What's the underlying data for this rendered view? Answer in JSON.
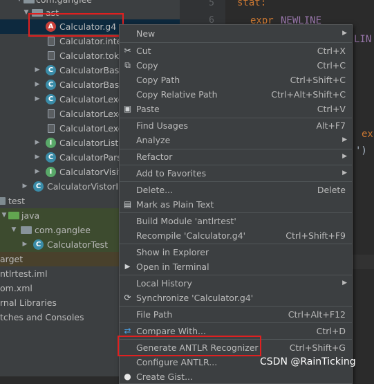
{
  "tree": {
    "partial_top": "com.ganglee",
    "partial_ast": "ast",
    "items": [
      {
        "label": "Calculator.g4",
        "icon": "antlr-file-icon"
      },
      {
        "label": "Calculator.inter",
        "icon": "text-file-icon"
      },
      {
        "label": "Calculator.toke",
        "icon": "text-file-icon"
      },
      {
        "label": "CalculatorBase",
        "icon": "class-icon"
      },
      {
        "label": "CalculatorBase",
        "icon": "class-icon"
      },
      {
        "label": "CalculatorLexer",
        "icon": "class-icon"
      },
      {
        "label": "CalculatorLexer",
        "icon": "text-file-icon"
      },
      {
        "label": "CalculatorLexer",
        "icon": "text-file-icon"
      },
      {
        "label": "CalculatorLister",
        "icon": "interface-icon"
      },
      {
        "label": "CalculatorParse",
        "icon": "class-icon"
      },
      {
        "label": "CalculatorVisito",
        "icon": "interface-icon"
      },
      {
        "label": "CalculatorVistorIm",
        "icon": "class-icon"
      },
      {
        "label": "test",
        "icon": "folder-icon"
      },
      {
        "label": "java",
        "icon": "folder-icon"
      },
      {
        "label": "com.ganglee",
        "icon": "package-icon"
      },
      {
        "label": "CalculatorTest",
        "icon": "class-icon"
      },
      {
        "label": "arget",
        "icon": "folder-icon"
      },
      {
        "label": "ntlrtest.iml",
        "icon": "file-icon"
      },
      {
        "label": "om.xml",
        "icon": "file-icon"
      },
      {
        "label": "rnal Libraries",
        "icon": "library-icon"
      },
      {
        "label": "tches and Consoles",
        "icon": "scratch-icon"
      }
    ]
  },
  "editor": {
    "line_numbers": [
      "5",
      "6"
    ],
    "code": {
      "stat": "stat:",
      "expr": "expr",
      "newline": "NEWLINE",
      "partial_newline2": "LIN",
      "partial_ex": "ex",
      "partial_paren": "')"
    }
  },
  "menu": {
    "items": [
      {
        "label": "New",
        "shortcut": "",
        "submenu": true,
        "icon": ""
      },
      {
        "label": "Cut",
        "shortcut": "Ctrl+X",
        "submenu": false,
        "icon": "cut-icon"
      },
      {
        "label": "Copy",
        "shortcut": "Ctrl+C",
        "submenu": false,
        "icon": "copy-icon"
      },
      {
        "label": "Copy Path",
        "shortcut": "Ctrl+Shift+C",
        "submenu": false,
        "icon": ""
      },
      {
        "label": "Copy Relative Path",
        "shortcut": "Ctrl+Alt+Shift+C",
        "submenu": false,
        "icon": ""
      },
      {
        "label": "Paste",
        "shortcut": "Ctrl+V",
        "submenu": false,
        "icon": "paste-icon"
      },
      {
        "label": "Find Usages",
        "shortcut": "Alt+F7",
        "submenu": false,
        "icon": ""
      },
      {
        "label": "Analyze",
        "shortcut": "",
        "submenu": true,
        "icon": ""
      },
      {
        "label": "Refactor",
        "shortcut": "",
        "submenu": true,
        "icon": ""
      },
      {
        "label": "Add to Favorites",
        "shortcut": "",
        "submenu": true,
        "icon": ""
      },
      {
        "label": "Delete...",
        "shortcut": "Delete",
        "submenu": false,
        "icon": ""
      },
      {
        "label": "Mark as Plain Text",
        "shortcut": "",
        "submenu": false,
        "icon": "plain-text-icon"
      },
      {
        "label": "Build Module 'antlrtest'",
        "shortcut": "",
        "submenu": false,
        "icon": ""
      },
      {
        "label": "Recompile 'Calculator.g4'",
        "shortcut": "Ctrl+Shift+F9",
        "submenu": false,
        "icon": ""
      },
      {
        "label": "Show in Explorer",
        "shortcut": "",
        "submenu": false,
        "icon": ""
      },
      {
        "label": "Open in Terminal",
        "shortcut": "",
        "submenu": false,
        "icon": "terminal-icon"
      },
      {
        "label": "Local History",
        "shortcut": "",
        "submenu": true,
        "icon": ""
      },
      {
        "label": "Synchronize 'Calculator.g4'",
        "shortcut": "",
        "submenu": false,
        "icon": "sync-icon"
      },
      {
        "label": "File Path",
        "shortcut": "Ctrl+Alt+F12",
        "submenu": false,
        "icon": ""
      },
      {
        "label": "Compare With...",
        "shortcut": "Ctrl+D",
        "submenu": false,
        "icon": "compare-icon"
      },
      {
        "label": "Generate ANTLR Recognizer",
        "shortcut": "Ctrl+Shift+G",
        "submenu": false,
        "icon": ""
      },
      {
        "label": "Configure ANTLR...",
        "shortcut": "",
        "submenu": false,
        "icon": ""
      },
      {
        "label": "Create Gist...",
        "shortcut": "",
        "submenu": false,
        "icon": "github-icon"
      }
    ]
  },
  "watermark": "CSDN @RainTicking",
  "colors": {
    "highlight_box": "#e02020",
    "selection": "#0d293e",
    "menu_bg": "#3c3f41",
    "keyword": "#cc7832",
    "token": "#9876aa"
  }
}
